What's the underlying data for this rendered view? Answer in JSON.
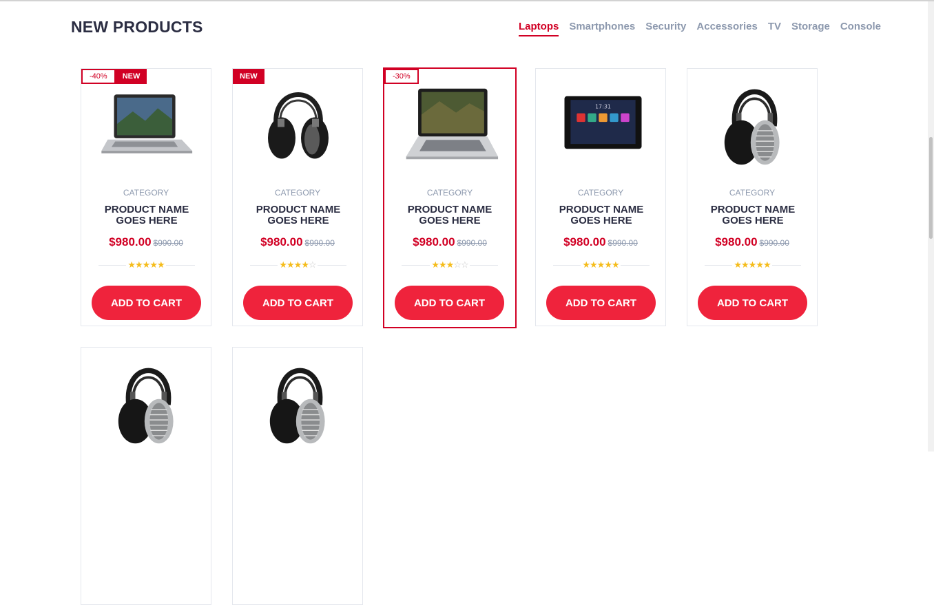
{
  "section": {
    "title": "NEW PRODUCTS",
    "tabs": [
      "Laptops",
      "Smartphones",
      "Security",
      "Accessories",
      "TV",
      "Storage",
      "Console"
    ]
  },
  "products": [
    {
      "label_sale": "-40%",
      "label_new": "NEW",
      "image": "laptop-icon",
      "category": "CATEGORY",
      "name": "PRODUCT NAME GOES HERE",
      "price": "$980.00",
      "old_price": "$990.00",
      "rating": 5,
      "button": "ADD TO CART"
    },
    {
      "label_new": "NEW",
      "image": "headphones-icon",
      "category": "CATEGORY",
      "name": "PRODUCT NAME GOES HERE",
      "price": "$980.00",
      "old_price": "$990.00",
      "rating": 4,
      "button": "ADD TO CART"
    },
    {
      "label_sale": "-30%",
      "image": "laptop-icon",
      "category": "CATEGORY",
      "name": "PRODUCT NAME GOES HERE",
      "price": "$980.00",
      "old_price": "$990.00",
      "rating": 3,
      "button": "ADD TO CART"
    },
    {
      "image": "tablet-icon",
      "category": "CATEGORY",
      "name": "PRODUCT NAME GOES HERE",
      "price": "$980.00",
      "old_price": "$990.00",
      "rating": 5,
      "button": "ADD TO CART"
    },
    {
      "image": "headphones-icon",
      "category": "CATEGORY",
      "name": "PRODUCT NAME GOES HERE",
      "price": "$980.00",
      "old_price": "$990.00",
      "rating": 5,
      "button": "ADD TO CART"
    },
    {
      "image": "headphones-icon"
    },
    {
      "image": "headphones-icon"
    }
  ],
  "colors": {
    "accent": "#d10024",
    "button": "#ef233c",
    "star": "#f5bc1a",
    "muted": "#8d99ae",
    "dark": "#2b2d42"
  }
}
